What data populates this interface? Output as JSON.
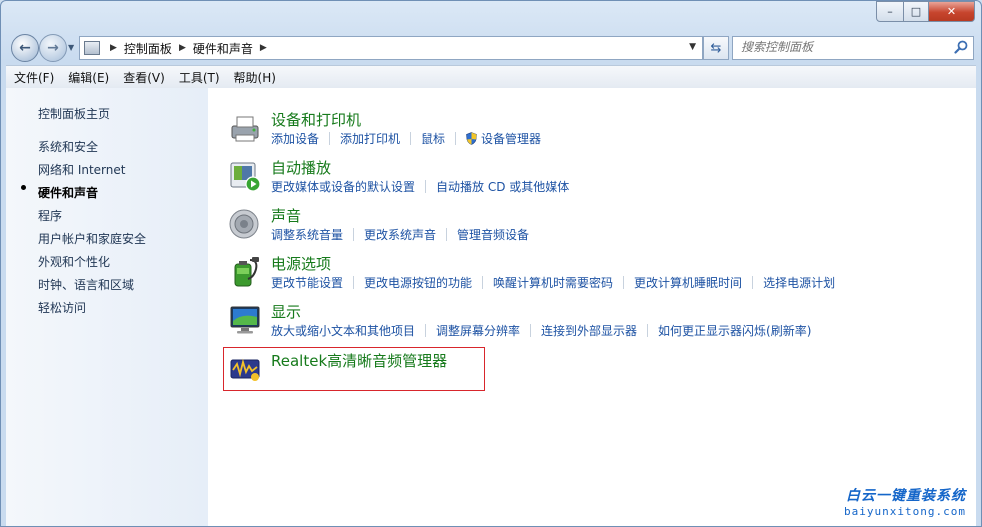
{
  "window": {
    "caption_buttons": {
      "minimize": "–",
      "maximize": "□",
      "close": "✕"
    }
  },
  "nav": {
    "breadcrumbs": [
      "控制面板",
      "硬件和声音"
    ],
    "search_placeholder": "搜索控制面板"
  },
  "menu": {
    "items": [
      "文件(F)",
      "编辑(E)",
      "查看(V)",
      "工具(T)",
      "帮助(H)"
    ]
  },
  "sidebar": {
    "items": [
      {
        "label": "控制面板主页"
      },
      {
        "label": "系统和安全"
      },
      {
        "label": "网络和 Internet"
      },
      {
        "label": "硬件和声音",
        "active": true
      },
      {
        "label": "程序"
      },
      {
        "label": "用户帐户和家庭安全"
      },
      {
        "label": "外观和个性化"
      },
      {
        "label": "时钟、语言和区域"
      },
      {
        "label": "轻松访问"
      }
    ]
  },
  "categories": [
    {
      "title": "设备和打印机",
      "icon": "printer-icon",
      "links": [
        "添加设备",
        "添加打印机",
        "鼠标",
        "设备管理器"
      ]
    },
    {
      "title": "自动播放",
      "icon": "autoplay-icon",
      "links": [
        "更改媒体或设备的默认设置",
        "自动播放 CD 或其他媒体"
      ]
    },
    {
      "title": "声音",
      "icon": "speaker-icon",
      "links": [
        "调整系统音量",
        "更改系统声音",
        "管理音频设备"
      ]
    },
    {
      "title": "电源选项",
      "icon": "battery-icon",
      "links": [
        "更改节能设置",
        "更改电源按钮的功能",
        "唤醒计算机时需要密码",
        "更改计算机睡眠时间",
        "选择电源计划"
      ]
    },
    {
      "title": "显示",
      "icon": "monitor-icon",
      "links": [
        "放大或缩小文本和其他项目",
        "调整屏幕分辨率",
        "连接到外部显示器",
        "如何更正显示器闪烁(刷新率)"
      ]
    },
    {
      "title": "Realtek高清晰音频管理器",
      "icon": "realtek-audio-icon",
      "links": []
    }
  ],
  "highlight_color": "#d8262c",
  "link_color": "#1d52a3",
  "title_color": "#167a1b",
  "watermark": {
    "name": "白云一键重装系统",
    "url": "baiyunxitong.com"
  }
}
